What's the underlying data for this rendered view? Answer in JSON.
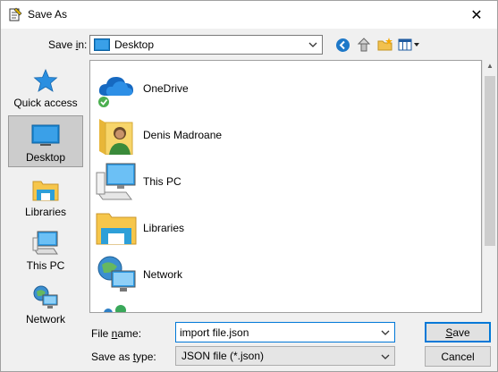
{
  "window": {
    "title": "Save As",
    "close_glyph": "✕"
  },
  "toolbar": {
    "save_in_label_pre": "Save ",
    "save_in_label_u": "i",
    "save_in_label_post": "n:",
    "save_in_value": "Desktop",
    "icons": [
      "back-icon",
      "up-folder-icon",
      "new-folder-icon",
      "view-menu-icon"
    ]
  },
  "places": [
    {
      "label": "Quick access",
      "icon": "star-icon",
      "selected": false
    },
    {
      "label": "Desktop",
      "icon": "desktop-icon",
      "selected": true
    },
    {
      "label": "Libraries",
      "icon": "libraries-icon",
      "selected": false
    },
    {
      "label": "This PC",
      "icon": "this-pc-icon",
      "selected": false
    },
    {
      "label": "Network",
      "icon": "network-icon",
      "selected": false
    }
  ],
  "files": [
    {
      "label": "OneDrive",
      "icon": "onedrive-icon"
    },
    {
      "label": "Denis Madroane",
      "icon": "user-folder-icon"
    },
    {
      "label": "This PC",
      "icon": "this-pc-icon"
    },
    {
      "label": "Libraries",
      "icon": "libraries-icon"
    },
    {
      "label": "Network",
      "icon": "network-icon"
    }
  ],
  "form": {
    "file_name_label_pre": "File ",
    "file_name_label_u": "n",
    "file_name_label_post": "ame:",
    "file_name_value": "import file.json",
    "save_as_type_label_pre": "Save as ",
    "save_as_type_label_u": "t",
    "save_as_type_label_post": "ype:",
    "save_as_type_value": "JSON file (*.json)",
    "save_button_pre": "",
    "save_button_u": "S",
    "save_button_post": "ave",
    "cancel_button": "Cancel"
  }
}
